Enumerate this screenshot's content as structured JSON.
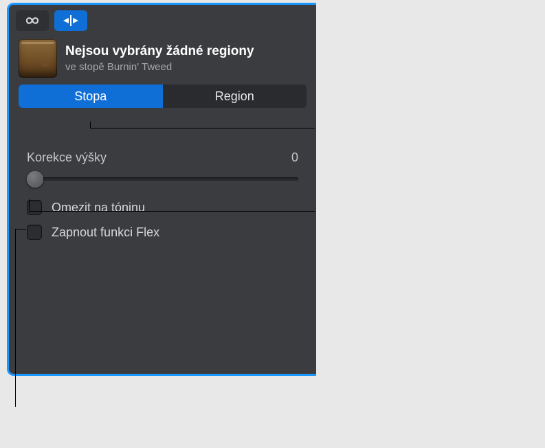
{
  "header": {
    "title": "Nejsou vybrány žádné regiony",
    "subtitle": "ve stopě Burnin' Tweed"
  },
  "tabs": {
    "left": "Stopa",
    "right": "Region"
  },
  "pitch": {
    "label": "Korekce výšky",
    "value": "0"
  },
  "checkboxes": {
    "limit_key": "Omezit na tóninu",
    "enable_flex": "Zapnout funkci Flex"
  }
}
